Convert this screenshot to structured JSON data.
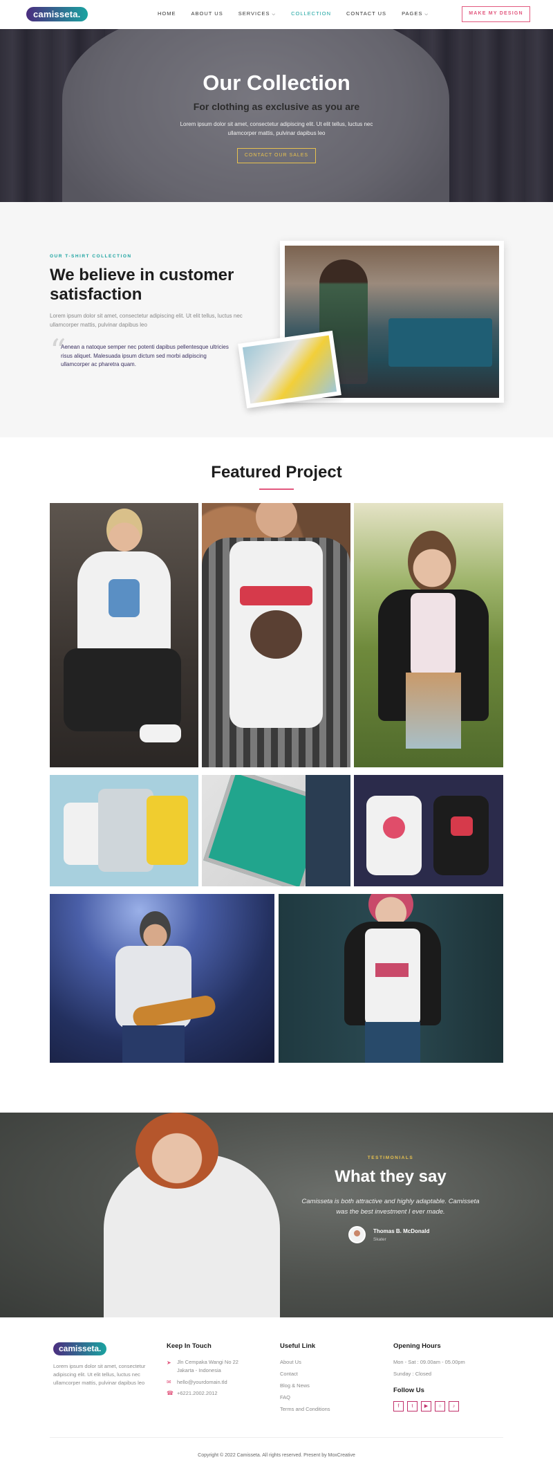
{
  "brand": {
    "name": "camisseta.",
    "accent": "#1aa3a0",
    "pink": "#e2577e",
    "purple": "#4b2d7f"
  },
  "nav": {
    "items": [
      {
        "label": "HOME"
      },
      {
        "label": "ABOUT US"
      },
      {
        "label": "SERVICES"
      },
      {
        "label": "COLLECTION"
      },
      {
        "label": "CONTACT US"
      },
      {
        "label": "PAGES"
      }
    ],
    "cta": "MAKE MY DESIGN"
  },
  "hero": {
    "title": "Our Collection",
    "subtitle": "For clothing as exclusive as you are",
    "text": "Lorem ipsum dolor sit amet, consectetur adipiscing elit. Ut elit tellus, luctus nec ullamcorper mattis, pulvinar dapibus leo",
    "button": "CONTACT OUR SALES"
  },
  "about": {
    "kicker": "OUR T-SHIRT COLLECTION",
    "title": "We believe in customer satisfaction",
    "text": "Lorem ipsum dolor sit amet, consectetur adipiscing elit. Ut elit tellus, luctus nec ullamcorper mattis, pulvinar dapibus leo",
    "quote": "Aenean a natoque semper nec potenti dapibus pellentesque ultricies risus aliquet. Malesuada ipsum dictum sed morbi adipiscing ullamcorper ac pharetra quam."
  },
  "featured": {
    "title": "Featured Project"
  },
  "testimonial": {
    "kicker": "TESTIMONIALS",
    "title": "What they say",
    "quote": "Camisseta is both attractive and highly adaptable. Camisseta was the best investment I ever made.",
    "name": "Thomas B. McDonald",
    "role": "Skater"
  },
  "footer": {
    "logo": "camisseta.",
    "description": "Lorem ipsum dolor sit amet, consectetur adipiscing elit. Ut elit tellus, luctus nec ullamcorper mattis, pulvinar dapibus leo",
    "keep_in_touch": {
      "title": "Keep In Touch",
      "address_line1": "Jln Cempaka Wangi No 22",
      "address_line2": "Jakarta - Indonesia",
      "email": "hello@yourdomain.tld",
      "phone": "+6221.2002.2012"
    },
    "useful_link": {
      "title": "Useful Link",
      "links": [
        "About Us",
        "Contact",
        "Blog & News",
        "FAQ",
        "Terms and Conditions"
      ]
    },
    "opening_hours": {
      "title": "Opening Hours",
      "weekdays": "Mon - Sat : 09.00am - 05.00pm",
      "sunday": "Sunday : Closed"
    },
    "follow_us": {
      "title": "Follow Us",
      "icons": [
        "facebook-icon",
        "twitter-icon",
        "youtube-icon",
        "instagram-icon",
        "tiktok-icon"
      ]
    },
    "copyright": "Copyright © 2022 Camisseta. All rights reserved. Present by MoxCreative"
  }
}
